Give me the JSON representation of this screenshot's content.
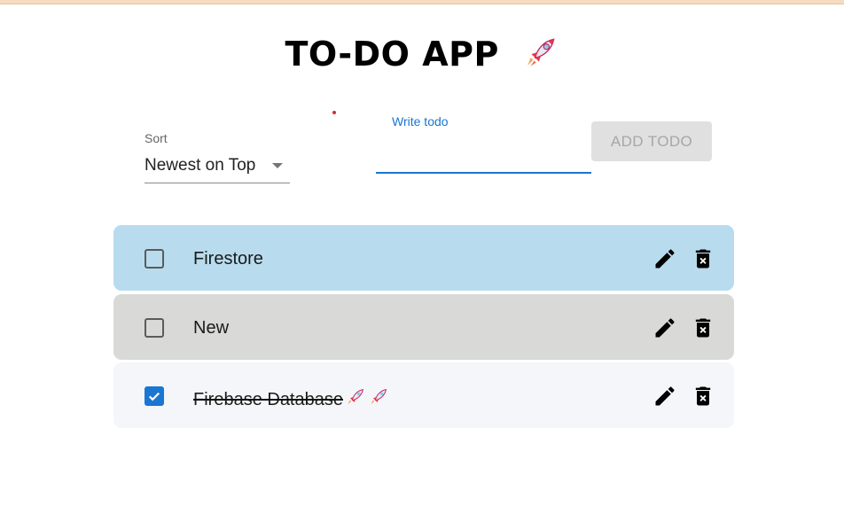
{
  "app": {
    "title": "TO-DO APP",
    "title_icon": "rocket-icon"
  },
  "controls": {
    "sort_label": "Sort",
    "sort_value": "Newest on Top",
    "input_label": "Write todo",
    "input_value": "",
    "add_button_label": "ADD TODO"
  },
  "todos": [
    {
      "text": "Firestore",
      "completed": false,
      "background": "#b8dcee",
      "trailing_icons": []
    },
    {
      "text": "New",
      "completed": false,
      "background": "#d9dad7",
      "trailing_icons": []
    },
    {
      "text": "Firebase Database",
      "completed": true,
      "background": "#f4f6f9",
      "trailing_icons": [
        "rocket-icon",
        "rocket-icon"
      ]
    }
  ],
  "colors": {
    "accent": "#1976d2",
    "disabled_button_bg": "#e0e0e0",
    "disabled_button_text": "#a7a7a7"
  }
}
